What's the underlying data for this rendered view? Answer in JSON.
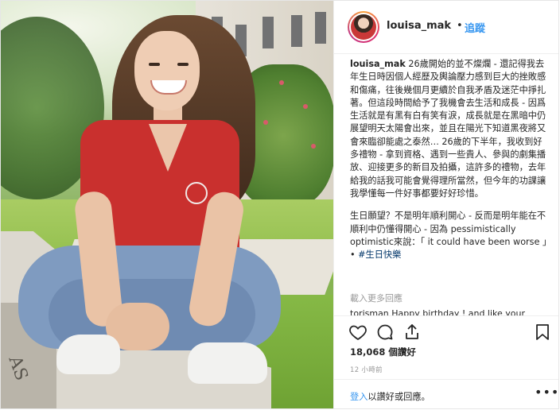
{
  "post": {
    "username": "louisa_mak",
    "separator": "•",
    "follow_label": "追蹤",
    "caption_user": "louisa_mak",
    "caption_paragraph_1": "26歲開始的並不燦爛 - 還記得我去年生日時因個人經歷及輿論壓力感到巨大的挫敗感和傷痛，往後幾個月更續於自我矛盾及迷茫中掙扎著。但這段時間給予了我機會去生活和成長 - 因爲生活就是有黑有白有笑有淚，成長就是在黑暗中仍展望明天太陽會出來，並且在陽光下知道黑夜將又會來臨卻能處之泰然… 26歲的下半年，我收到好多禮物 - 拿到資格、遇到一些貴人、參與的劇集播放、迎接更多的新目及拍攝，這許多的禮物，去年給我的話我可能會覺得理所當然，但今年的功課讓我學懂每一件好事都要好好珍惜。",
    "caption_paragraph_2": "生日願望？不是明年順利開心 - 反而是明年能在不順利中仍懂得開心 - 因為 pessimistically optimistic來說：「 it could have been worse 」•",
    "hashtag": "#生日快樂",
    "load_more": "載入更多回應",
    "next_comment": "torisman Happy birthday ! and like your",
    "likes": "18,068 個讚好",
    "time": "12 小時前",
    "login_link": "登入",
    "login_suffix": "以讚好或回應。",
    "more_icon": "•••"
  },
  "photo": {
    "bench_lettering": "AS"
  },
  "icons": [
    "heart-icon",
    "comment-icon",
    "share-icon",
    "bookmark-icon"
  ]
}
